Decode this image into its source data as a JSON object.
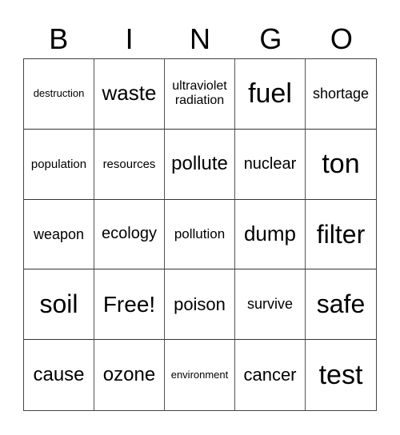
{
  "header": [
    "B",
    "I",
    "N",
    "G",
    "O"
  ],
  "cells": [
    [
      "destruction",
      "waste",
      "ultraviolet radiation",
      "fuel",
      "shortage"
    ],
    [
      "population",
      "resources",
      "pollute",
      "nuclear",
      "ton"
    ],
    [
      "weapon",
      "ecology",
      "pollution",
      "dump",
      "filter"
    ],
    [
      "soil",
      "Free!",
      "poison",
      "survive",
      "safe"
    ],
    [
      "cause",
      "ozone",
      "environment",
      "cancer",
      "test"
    ]
  ]
}
